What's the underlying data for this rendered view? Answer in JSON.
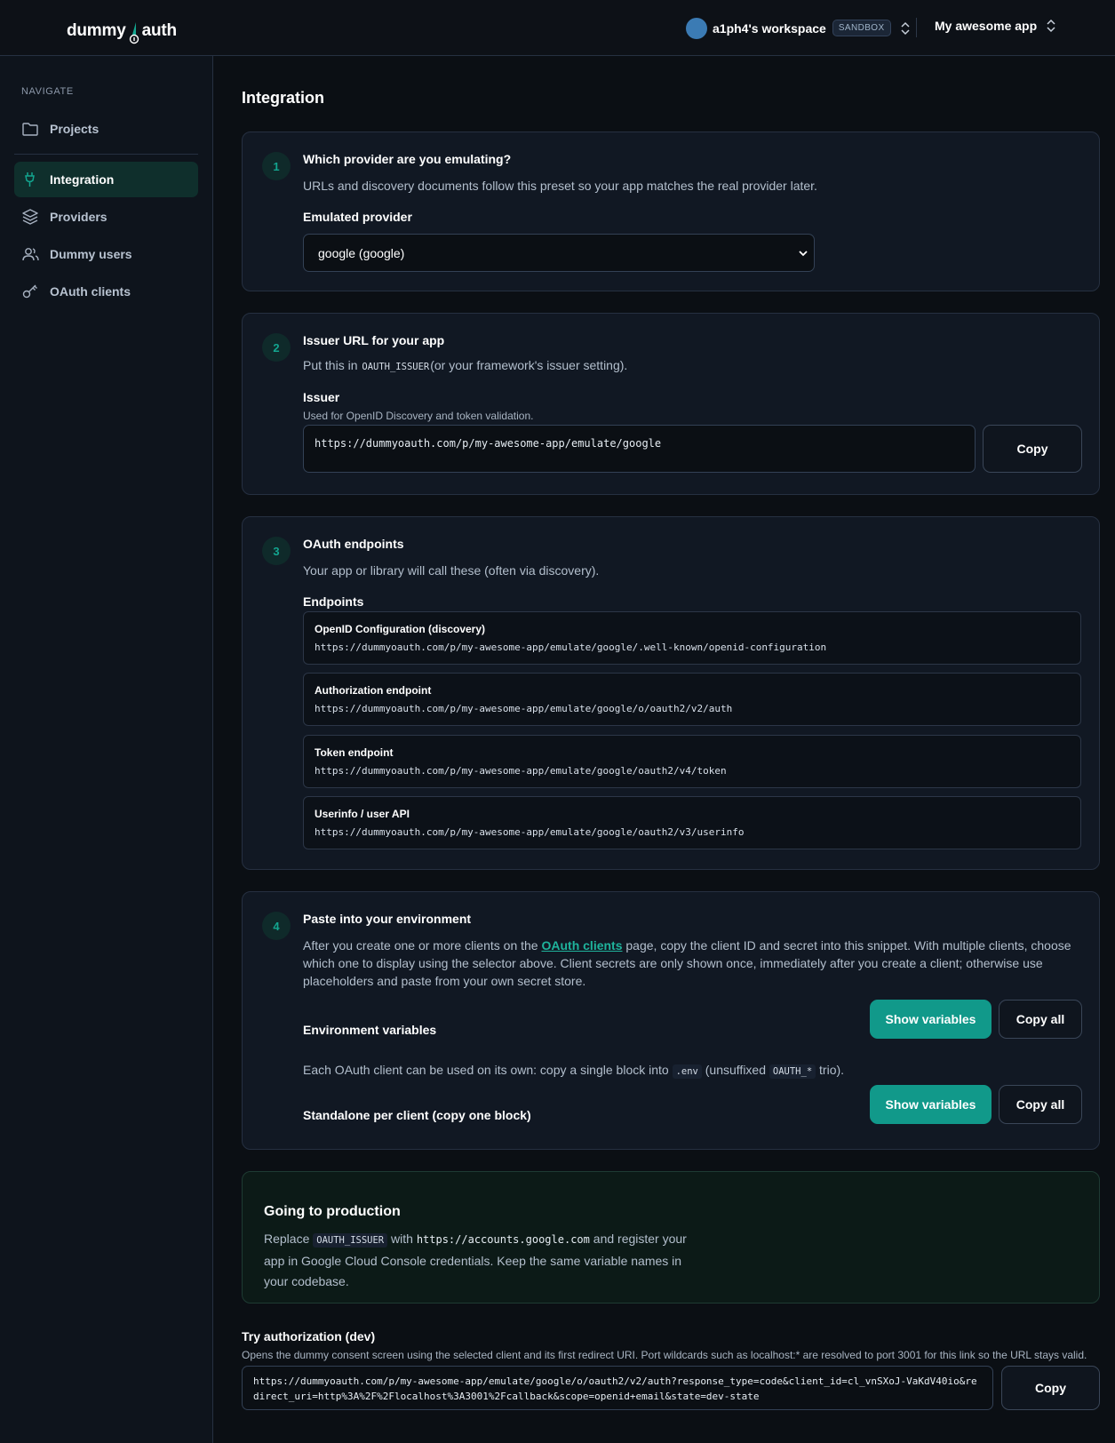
{
  "header": {
    "logo_left": "dummy",
    "logo_right": "auth",
    "workspace_name": "a1ph4's workspace",
    "workspace_badge": "SANDBOX",
    "app_name": "My awesome app"
  },
  "sidebar": {
    "heading": "NAVIGATE",
    "items": [
      {
        "label": "Projects",
        "icon": "folder-icon"
      },
      {
        "label": "Integration",
        "icon": "plug-icon",
        "active": true
      },
      {
        "label": "Providers",
        "icon": "layers-icon"
      },
      {
        "label": "Dummy users",
        "icon": "users-icon"
      },
      {
        "label": "OAuth clients",
        "icon": "key-icon"
      }
    ]
  },
  "page": {
    "title": "Integration"
  },
  "step1": {
    "number": "1",
    "title": "Which provider are you emulating?",
    "desc": "URLs and discovery documents follow this preset so your app matches the real provider later.",
    "label": "Emulated provider",
    "selected": "google (google)"
  },
  "step2": {
    "number": "2",
    "title": "Issuer URL for your app",
    "desc_before": "Put this in",
    "desc_code": "OAUTH_ISSUER",
    "desc_after": "(or your framework's issuer setting).",
    "label": "Issuer",
    "sublabel": "Used for OpenID Discovery and token validation.",
    "value": "https://dummyoauth.com/p/my-awesome-app/emulate/google",
    "copy_label": "Copy"
  },
  "step3": {
    "number": "3",
    "title": "OAuth endpoints",
    "desc": "Your app or library will call these (often via discovery).",
    "label": "Endpoints",
    "endpoints": [
      {
        "title": "OpenID Configuration (discovery)",
        "url": "https://dummyoauth.com/p/my-awesome-app/emulate/google/.well-known/openid-configuration"
      },
      {
        "title": "Authorization endpoint",
        "url": "https://dummyoauth.com/p/my-awesome-app/emulate/google/o/oauth2/v2/auth"
      },
      {
        "title": "Token endpoint",
        "url": "https://dummyoauth.com/p/my-awesome-app/emulate/google/oauth2/v4/token"
      },
      {
        "title": "Userinfo / user API",
        "url": "https://dummyoauth.com/p/my-awesome-app/emulate/google/oauth2/v3/userinfo"
      }
    ]
  },
  "step4": {
    "number": "4",
    "title": "Paste into your environment",
    "desc_before": "After you create one or more clients on the",
    "desc_link": "OAuth clients",
    "desc_after": "page, copy the client ID and secret into this snippet. With multiple clients, choose which one to display using the selector above. Client secrets are only shown once, immediately after you create a client; otherwise use placeholders and paste from your own secret store.",
    "env_label": "Environment variables",
    "show_label": "Show variables",
    "copy_all_label": "Copy all",
    "standalone_before": "Each OAuth client can be used on its own: copy a single block into",
    "standalone_code1": ".env",
    "standalone_mid": "(unsuffixed",
    "standalone_code2": "OAUTH_*",
    "standalone_after": "trio).",
    "standalone_label": "Standalone per client (copy one block)"
  },
  "production": {
    "title": "Going to production",
    "desc_before": "Replace",
    "code1": "OAUTH_ISSUER",
    "desc_mid": "with",
    "code2": "https://accounts.google.com",
    "desc_after": "and register your app in Google Cloud Console credentials. Keep the same variable names in your codebase."
  },
  "try": {
    "title": "Try authorization (dev)",
    "desc": "Opens the dummy consent screen using the selected client and its first redirect URI. Port wildcards such as localhost:* are resolved to port 3001 for this link so the URL stays valid.",
    "url": "https://dummyoauth.com/p/my-awesome-app/emulate/google/o/oauth2/v2/auth?response_type=code&client_id=cl_vnSXoJ-VaKdV40io&redirect_uri=http%3A%2F%2Flocalhost%3A3001%2Fcallback&scope=openid+email&state=dev-state",
    "copy_label": "Copy"
  },
  "colors": {
    "accent": "#11998a",
    "background": "#0b0f14",
    "card": "#111823"
  }
}
